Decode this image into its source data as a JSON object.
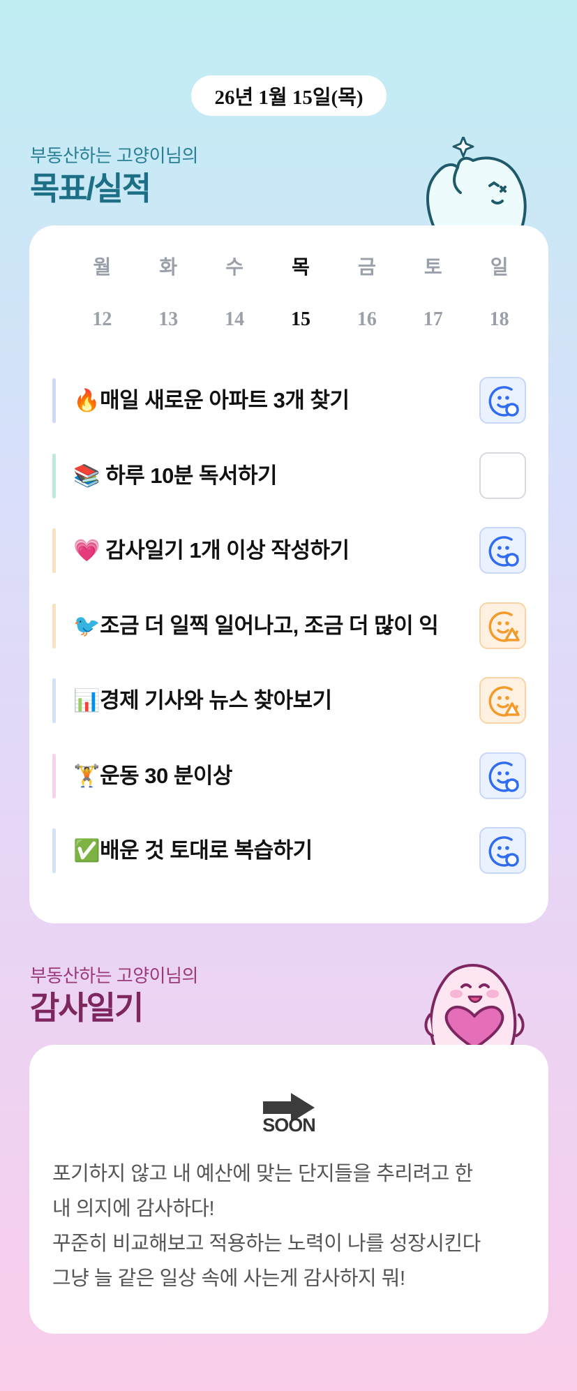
{
  "date_label": "26년 1월 15일(목)",
  "goals_section": {
    "subtitle": "부동산하는 고양이님의",
    "title": "목표/실적"
  },
  "week": {
    "days": [
      "월",
      "화",
      "수",
      "목",
      "금",
      "토",
      "일"
    ],
    "dates": [
      "12",
      "13",
      "14",
      "15",
      "16",
      "17",
      "18"
    ],
    "active_index": 3
  },
  "goals": [
    {
      "text": "🔥매일 새로운 아파트 3개 찾기",
      "status": "done",
      "bar_color": "#cfdaf7"
    },
    {
      "text": "📚 하루 10분 독서하기",
      "status": "empty",
      "bar_color": "#bfeadd"
    },
    {
      "text": "💗 감사일기 1개 이상 작성하기",
      "status": "done",
      "bar_color": "#fbe1c4"
    },
    {
      "text": "🐦조금 더 일찍 일어나고, 조금 더 많이 익",
      "status": "partial",
      "bar_color": "#fbe1c4"
    },
    {
      "text": "📊경제 기사와 뉴스 찾아보기",
      "status": "partial",
      "bar_color": "#d6e0f7"
    },
    {
      "text": "🏋운동 30 분이상",
      "status": "done",
      "bar_color": "#f6d3ea"
    },
    {
      "text": "✅배운 것 토대로 복습하기",
      "status": "done",
      "bar_color": "#d6e0f7"
    }
  ],
  "diary_section": {
    "subtitle": "부동산하는 고양이님의",
    "title": "감사일기",
    "soon_label": "SOON",
    "lines": [
      "포기하지 않고 내 예산에 맞는 단지들을 추리려고 한",
      "내 의지에 감사하다!",
      "꾸준히 비교해보고 적용하는 노력이 나를 성장시킨다",
      "그냥 늘 같은 일상 속에 사는게 감사하지 뭐!"
    ]
  },
  "colors": {
    "done": "#2f6cf0",
    "partial": "#f39a2a",
    "title_teal": "#1d6f86",
    "title_plum": "#7d2660"
  },
  "icons": {
    "done": "smile-face-check-icon",
    "partial": "smile-face-warning-icon",
    "soon": "arrow-right-icon"
  }
}
